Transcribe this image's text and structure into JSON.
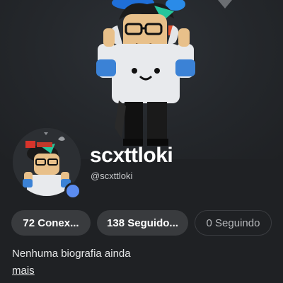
{
  "profile": {
    "display_name": "scxttloki",
    "username": "@scxttloki",
    "online_status_color": "#5b8cf0"
  },
  "stats": {
    "connections_label": "72 Conex...",
    "followers_label": "138 Seguido...",
    "following_label": "0 Seguindo"
  },
  "bio": {
    "text": "Nenhuma biografia ainda",
    "more_label": "mais"
  },
  "colors": {
    "background": "#1f2124",
    "pill": "#393b3e",
    "accent": "#5b8cf0"
  }
}
